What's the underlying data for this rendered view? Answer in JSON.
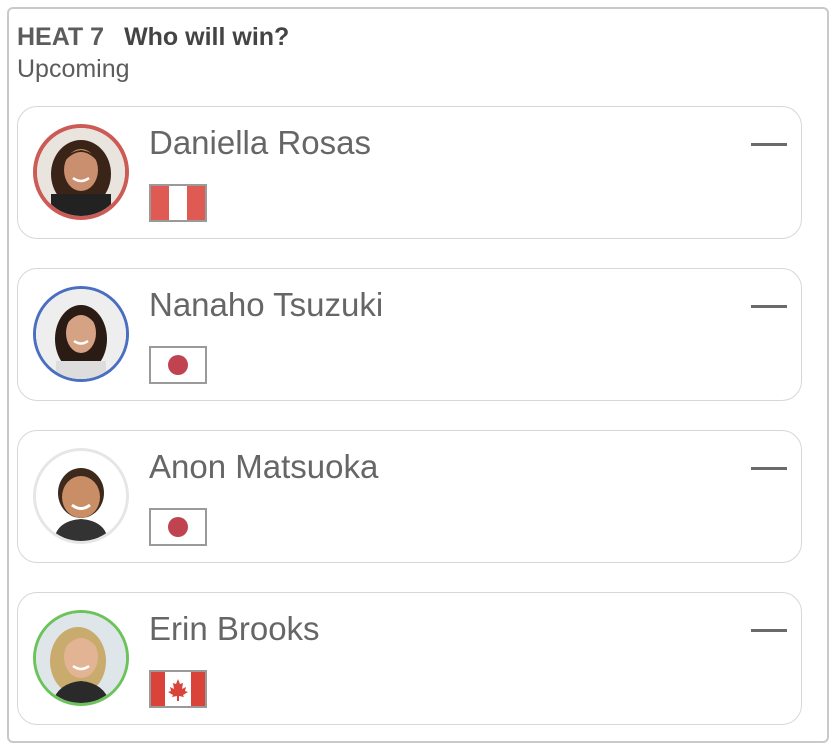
{
  "heat": {
    "label": "HEAT 7",
    "question": "Who will win?",
    "status": "Upcoming"
  },
  "athletes": [
    {
      "name": "Daniella Rosas",
      "flag": "peru-flag-icon",
      "ring_color": "#cc5a55",
      "skin": "#c98f6e",
      "hair": "#3a2418"
    },
    {
      "name": "Nanaho Tsuzuki",
      "flag": "japan-flag-icon",
      "ring_color": "#4a6fc0",
      "skin": "#d6a284",
      "hair": "#2a1b14"
    },
    {
      "name": "Anon Matsuoka",
      "flag": "japan-flag-icon",
      "ring_color": "#e6e6e6",
      "skin": "#c98e66",
      "hair": "#3d2a1d"
    },
    {
      "name": "Erin Brooks",
      "flag": "canada-flag-icon",
      "ring_color": "#6cc35a",
      "skin": "#e2b493",
      "hair": "#c9ab6e"
    }
  ],
  "odds_placeholder": "—"
}
